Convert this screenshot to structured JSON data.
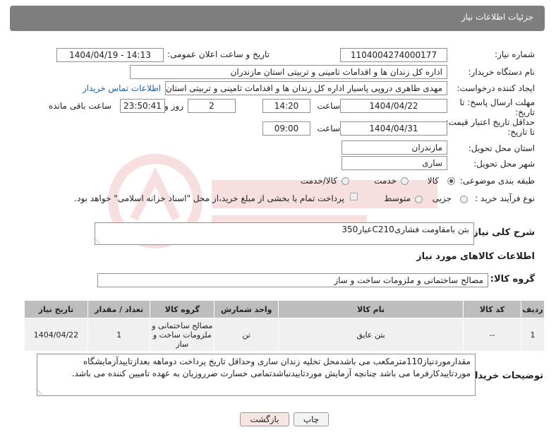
{
  "header": {
    "title": "جزئیات اطلاعات نیاز"
  },
  "fields": {
    "need_number_label": "شماره نیاز:",
    "need_number": "1104004274000177",
    "announce_label": "تاریخ و ساعت اعلان عمومی:",
    "announce_value": "1404/04/19 - 14:13",
    "buyer_org_label": "نام دستگاه خریدار:",
    "buyer_org": "اداره کل زندان ها و اقدامات تامینی و تربیتی استان مازندران",
    "requester_label": "ایجاد کننده درخواست:",
    "requester": "مهدی طاهری دروپی پاسیار اداره کل زندان ها و اقدامات تامینی و تربیتی استان",
    "contact_link": "اطلاعات تماس خریدار",
    "deadline_label_1": "مهلت ارسال پاسخ: تا",
    "deadline_label_2": "تاریخ:",
    "deadline_date": "1404/04/22",
    "time_label": "ساعت",
    "deadline_time": "14:20",
    "days_value": "2",
    "days_label": "روز و",
    "remaining_time": "23:50:41",
    "remaining_label": "ساعت باقی مانده",
    "price_validity_label_1": "حداقل تاریخ اعتبار قیمت:",
    "price_validity_label_2": "تا تاریخ:",
    "price_validity_date": "1404/04/31",
    "price_validity_time": "09:00",
    "delivery_province_label": "استان محل تحویل:",
    "delivery_province": "مازندران",
    "delivery_city_label": "شهر محل تحویل:",
    "delivery_city": "ساری",
    "category_label": "طبقه بندی موضوعی:",
    "category_options": [
      "کالا",
      "خدمت",
      "کالا/خدمت"
    ],
    "category_selected": "کالا",
    "process_label": "نوع فرآیند خرید :",
    "process_options": [
      "جزیی",
      "متوسط"
    ],
    "payment_note": "پرداخت تمام یا بخشی از مبلغ خرید،از محل \"اسناد خزانه اسلامی\" خواهد بود."
  },
  "description": {
    "label": "شرح کلی نیاز:",
    "value": "بتن بامقاومت فشاریC210عیار350"
  },
  "goods_info": {
    "title": "اطلاعات کالاهای مورد نیاز",
    "group_label": "گروه کالا:",
    "group_value": "مصالح ساختمانی و ملزومات ساخت و ساز"
  },
  "table": {
    "headers": [
      "ردیف",
      "کد کالا",
      "نام کالا",
      "واحد شمارش",
      "گروه کالا",
      "تعداد / مقدار",
      "تاریخ نیاز"
    ],
    "rows": [
      [
        "1",
        "--",
        "بتن عایق",
        "تن",
        "مصالح ساختمانی و ملزومات ساخت و ساز",
        "1",
        "1404/04/22"
      ]
    ]
  },
  "buyer_notes": {
    "label": "توضیحات خریدار:",
    "value": "مقدارموردنیاز110مترمکعب می باشدمحل تخلیه زندان ساری وحداقل تاریخ پرداخت دوماهه بعدازتاییدآزمایشگاه موردتاییدکارفرما می باشد چنانچه آزمایش موردتاییدنباشدتمامی خسارت ضرروزیان به عهده تامیین کننده می باشد."
  },
  "buttons": {
    "print": "چاپ",
    "back": "بازگشت"
  },
  "colors": {
    "header_bg": "#7e7e7e",
    "link": "#1a5fb4",
    "back_btn_bg": "#f9e4e4"
  }
}
